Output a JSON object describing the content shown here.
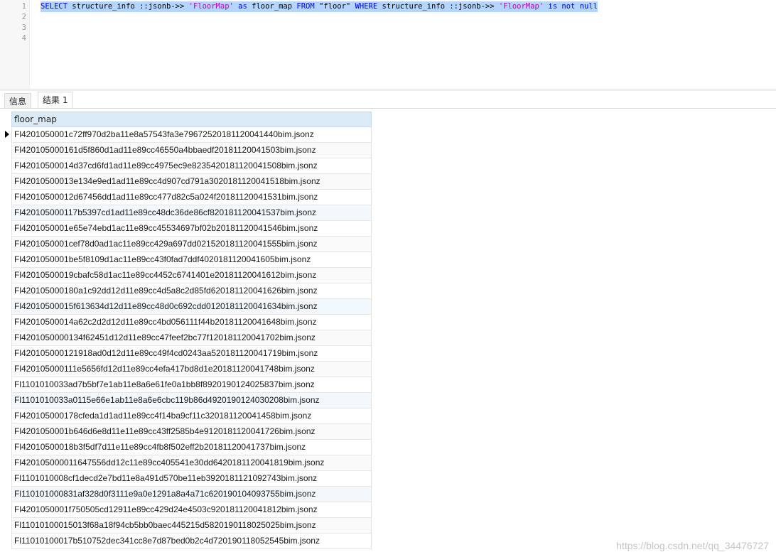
{
  "editor": {
    "line_numbers": [
      "1",
      "2",
      "3",
      "4"
    ],
    "sql_tokens": [
      {
        "text": "SELECT",
        "kind": "kw"
      },
      {
        "text": " structure_info ::jsonb->> ",
        "kind": "plain"
      },
      {
        "text": "'FloorMap'",
        "kind": "str"
      },
      {
        "text": " ",
        "kind": "plain"
      },
      {
        "text": "as",
        "kind": "kw"
      },
      {
        "text": " floor_map ",
        "kind": "plain"
      },
      {
        "text": "FROM",
        "kind": "kw"
      },
      {
        "text": " \"floor\" ",
        "kind": "plain"
      },
      {
        "text": "WHERE",
        "kind": "kw"
      },
      {
        "text": " structure_info ::jsonb->> ",
        "kind": "plain"
      },
      {
        "text": "'FloorMap'",
        "kind": "str"
      },
      {
        "text": " ",
        "kind": "plain"
      },
      {
        "text": "is",
        "kind": "kw"
      },
      {
        "text": " ",
        "kind": "plain"
      },
      {
        "text": "not",
        "kind": "kw"
      },
      {
        "text": " ",
        "kind": "plain"
      },
      {
        "text": "null",
        "kind": "kw"
      }
    ],
    "colors": {
      "keyword": "#0000ff",
      "string": "#c000c0",
      "selection": "#b4d5ff"
    }
  },
  "tabs": [
    {
      "label": "信息",
      "active": false
    },
    {
      "label": "结果 1",
      "active": true
    }
  ],
  "grid": {
    "column": "floor_map",
    "rows": [
      "Fl4201050001c72ff970d2ba11e8a57543fa3e7967252018112004144​0bim.jsonz",
      "Fl420105000161d5f860d1ad11e89cc46550a4bbaedf20181120041503bim.jsonz",
      "Fl42010500014d37cd6fd1ad11e89cc4975ec9e8235420181120041508bim.jsonz",
      "Fl42010500013e134e9ed1ad11e89cc4d907cd791a3020181120041518bim.jsonz",
      "Fl42010500012d67456dd1ad11e89cc477d82c5a024f20181120041531bim.jsonz",
      "Fl420105000117b5397cd1ad11e89cc48dc36de86cf820181120041537bim.jsonz",
      "Fl4201050001e65e74ebd1ac11e89cc45534697bf02b20181120041546bim.jsonz",
      "Fl4201050001cef78d0ad1ac11e89cc429a697dd0215201811200415​55bim.jsonz",
      "Fl4201050001be5f8109d1ac11e89cc43f0fad7ddf4020181120041605bim.jsonz",
      "Fl42010500019cbafc58d1ac11e89cc4452c6741401e20181120041612bim.jsonz",
      "Fl420105000180a1c92dd12d11e89cc4d5a8c2d85fd620181120041626bim.jsonz",
      "Fl42010500015f613634d12d11e89cc48d0c692cdd0120181120041634bim.jsonz",
      "Fl42010500014a62c2d2d12d11e89cc4bd056111f44b20181120041648bim.jsonz",
      "Fl4201050000134f62451d12d11e89cc47feef2bc77f120181120041702bim.jsonz",
      "Fl420105000121918ad0d12d11e89cc49f4cd0243aa520181120041719bim.jsonz",
      "Fl420105000111e5656fd12d11e89cc4efa417bd8d1e20181120041748bim.jsonz",
      "Fl1101010033ad7b5bf7e1ab11e8a6e61fe0a1bb8f8920190124025837bim.jsonz",
      "Fl1101010033a0115e66e1ab11e8a6e6cbc119b86d4920190124030208bim.jsonz",
      "Fl420105000178cfeda1d1ad11e89cc4f14ba9cf11c320181120041458bim.jsonz",
      "Fl4201050001b646d6e8d11e11e89cc43ff2585b4e9120181120041726bim.jsonz",
      "Fl42010500018b3f5df7d11e11e89cc4fb8f502eff2b20181120041737bim.jsonz",
      "Fl420105000011647556dd12c11e89cc405541e30dd6420181120041819bim.jsonz",
      "Fl1101010008cf1decd2e7bd11e8a491d570be11eb3920181121092743bim.jsonz",
      "Fl110101000831af328d0f3111e9a0e1291a8a4a71c620190104093755bim.jsonz",
      "Fl4201050001f750505cd12911e89cc429d24e4503c920181120041812bim.jsonz",
      "Fl11010100015013f68a18f94cb5bb0baec445215d5820190118025025bim.jsonz",
      "Fl11010100017b510752dec341cc8e7d87bed0b2c4d720190118052545bim.jsonz"
    ]
  },
  "watermark": "https://blog.csdn.net/qq_34476727"
}
